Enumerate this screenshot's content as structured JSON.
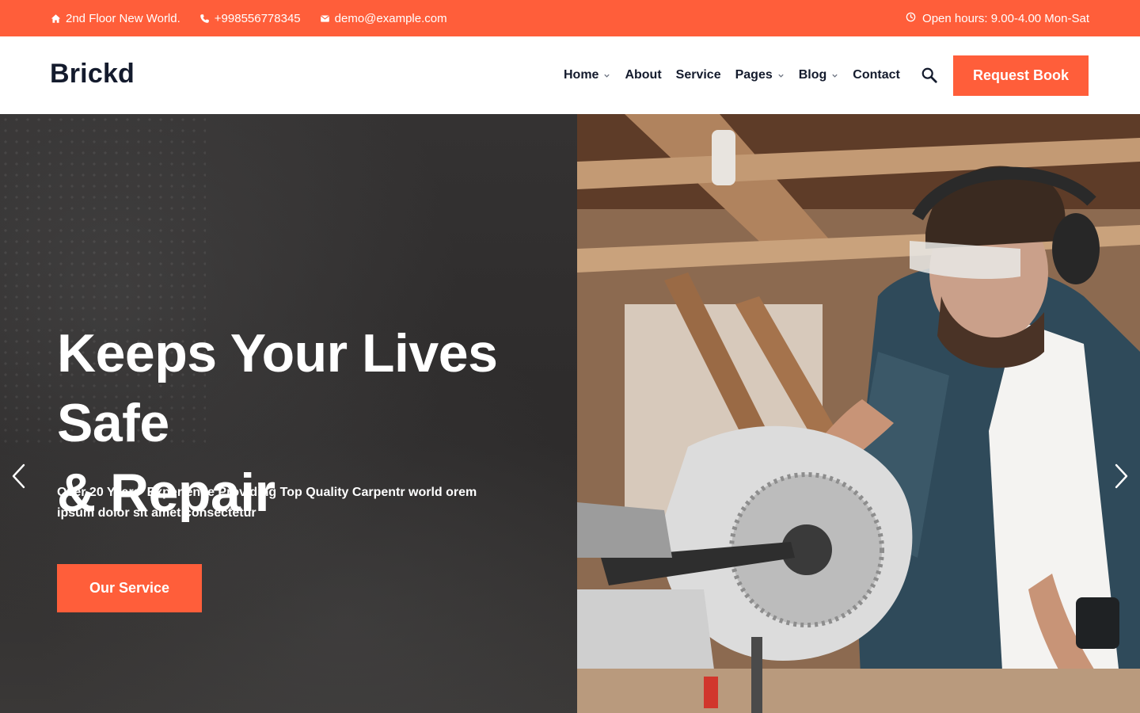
{
  "colors": {
    "accent": "#ff5e3a",
    "dark": "#141b2d",
    "hero_dark": "#2f2d2d"
  },
  "topbar": {
    "address": "2nd Floor New World.",
    "phone": "+998556778345",
    "email": "demo@example.com",
    "hours": "Open hours: 9.00-4.00 Mon-Sat",
    "icons": [
      "home-icon",
      "phone-icon",
      "mail-icon",
      "clock-icon"
    ]
  },
  "header": {
    "logo": "Brickd",
    "nav": [
      {
        "label": "Home",
        "dropdown": true
      },
      {
        "label": "About",
        "dropdown": false
      },
      {
        "label": "Service",
        "dropdown": false
      },
      {
        "label": "Pages",
        "dropdown": true
      },
      {
        "label": "Blog",
        "dropdown": true
      },
      {
        "label": "Contact",
        "dropdown": false
      }
    ],
    "search_icon": "search-icon",
    "cta_label": "Request Book"
  },
  "hero": {
    "title_line1": "Keeps Your Lives Safe",
    "title_line2": "& Repair",
    "subtitle": "Over 20 Years’ Experience Providing Top Quality Carpentr world orem ipsum dolor sit amet consectetur",
    "button_label": "Our Service",
    "image_subject": "carpenter with safety glasses and ear protection using a circular miter saw",
    "arrows": [
      "chevron-left-icon",
      "chevron-right-icon"
    ]
  }
}
